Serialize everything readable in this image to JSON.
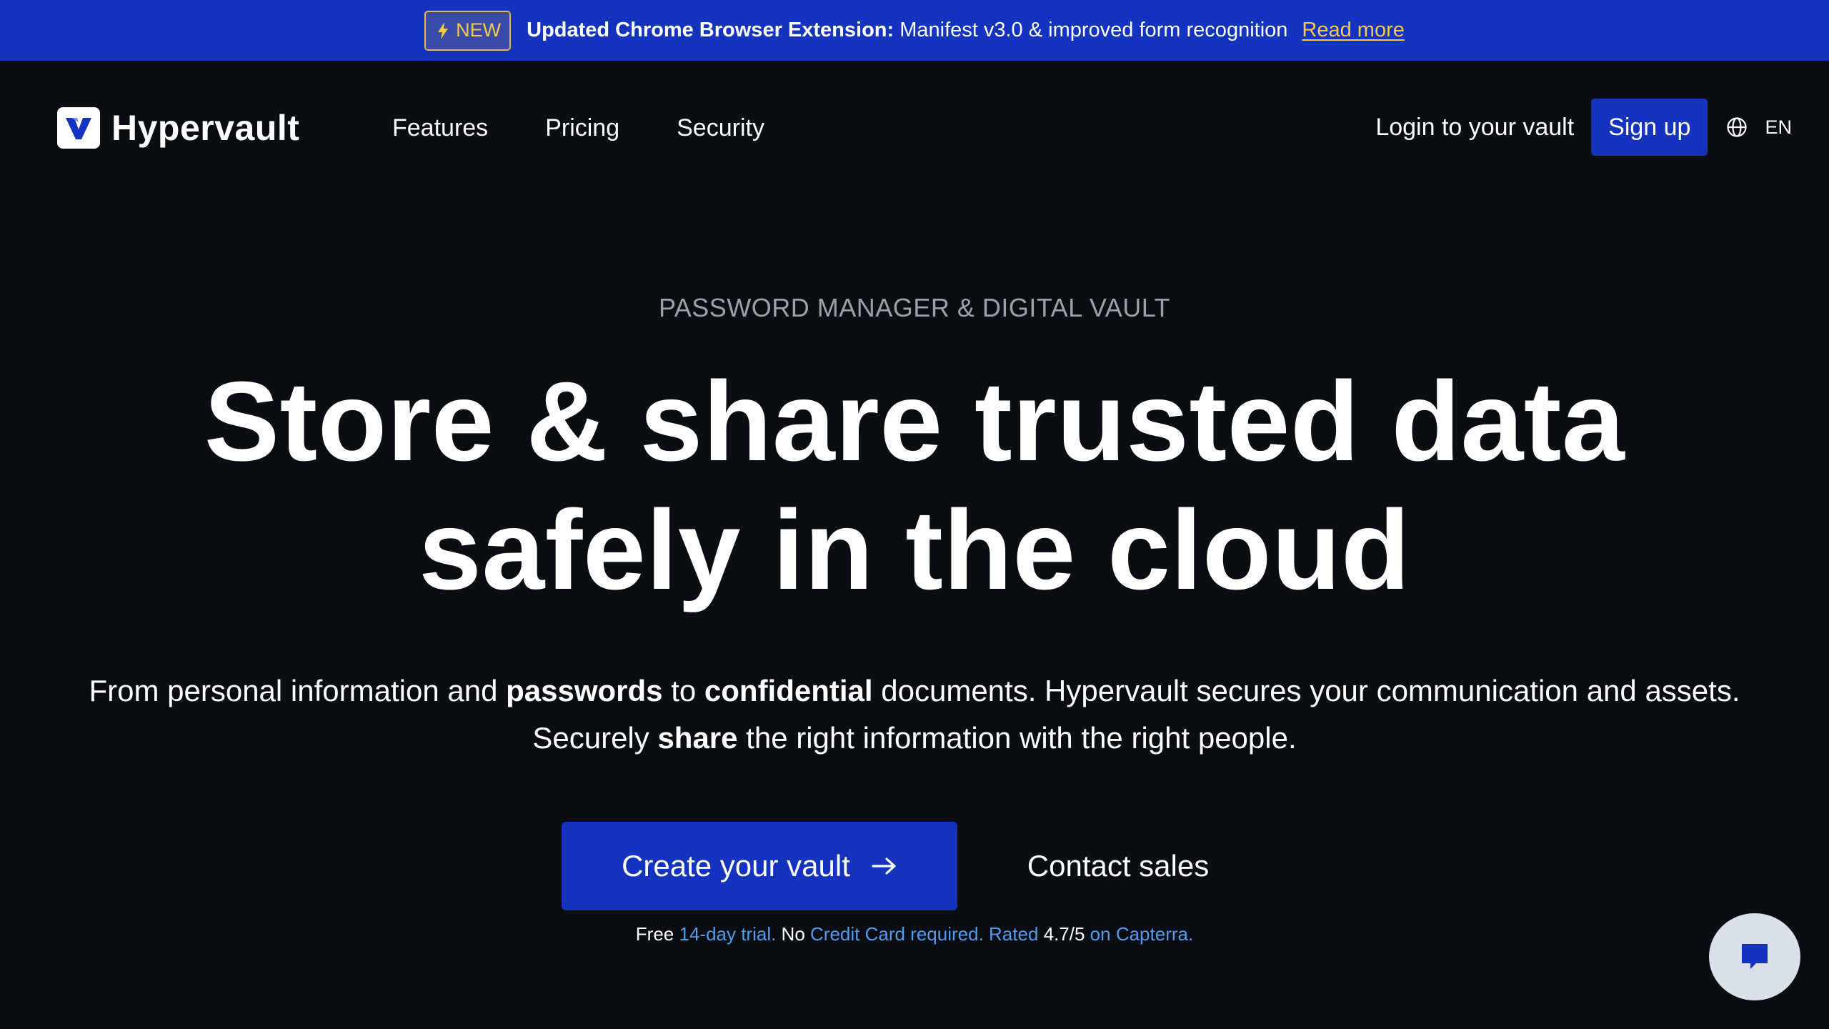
{
  "banner": {
    "badge_label": "NEW",
    "badge_icon": "lightning-bolt-icon",
    "title": "Updated Chrome Browser Extension:",
    "message": " Manifest v3.0 & improved form recognition",
    "link_label": "Read more"
  },
  "navbar": {
    "brand": "Hypervault",
    "links": [
      "Features",
      "Pricing",
      "Security"
    ],
    "login_label": "Login to your vault",
    "signup_label": "Sign up",
    "language": "EN",
    "language_icon": "globe-icon"
  },
  "hero": {
    "eyebrow": "PASSWORD MANAGER & DIGITAL VAULT",
    "headline_line1": "Store & share trusted data",
    "headline_line2": "safely in the cloud",
    "sub": {
      "t1": "From personal information and ",
      "b1": "passwords",
      "t2": " to ",
      "b2": "confidential",
      "t3": " documents. Hypervault secures your communication and assets. Securely ",
      "b3": "share",
      "t4": " the right information with the right people."
    }
  },
  "cta": {
    "primary_label": "Create your vault",
    "primary_icon": "arrow-right-icon",
    "secondary_label": "Contact sales"
  },
  "trial_note": {
    "p1": "Free ",
    "p2": "14-day trial.",
    "p3": " No ",
    "p4": "Credit Card required.",
    "p5": " Rated ",
    "p6": "4.7/5",
    "p7": " on Capterra."
  },
  "chat": {
    "icon": "chat-bubble-icon"
  },
  "colors": {
    "background": "#0a0e12",
    "brand_blue": "#1433bf",
    "badge_yellow": "#f5c94f",
    "link_blue": "#4f9cf0",
    "muted_gray": "#9aa1aa"
  }
}
